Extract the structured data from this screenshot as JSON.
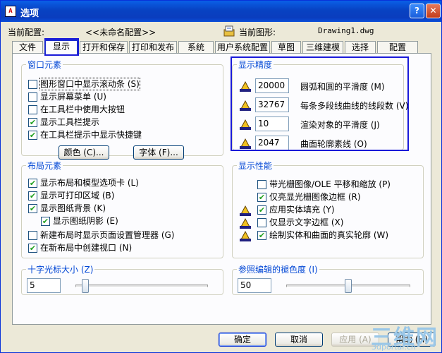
{
  "window": {
    "title": "选项",
    "app_icon_text": "A"
  },
  "titlebar": {
    "help_glyph": "?",
    "close_glyph": "✕"
  },
  "config": {
    "current_profile_label": "当前配置:",
    "current_profile_value": "<<未命名配置>>",
    "current_drawing_label": "当前图形:",
    "current_drawing_value": "Drawing1.dwg"
  },
  "tabs": [
    "文件",
    "显示",
    "打开和保存",
    "打印和发布",
    "系统",
    "用户系统配置",
    "草图",
    "三维建模",
    "选择",
    "配置"
  ],
  "window_elements": {
    "legend": "窗口元素",
    "options": [
      {
        "label": "图形窗口中显示滚动条 (S)",
        "checked": false
      },
      {
        "label": "显示屏幕菜单 (U)",
        "checked": false
      },
      {
        "label": "在工具栏中使用大按钮",
        "checked": false
      },
      {
        "label": "显示工具栏提示",
        "checked": true
      },
      {
        "label": "在工具栏提示中显示快捷键",
        "checked": true
      }
    ],
    "color_button": "颜色 (C)...",
    "font_button": "字体 (F)..."
  },
  "display_resolution": {
    "legend": "显示精度",
    "items": [
      {
        "value": "20000",
        "label": "圆弧和圆的平滑度 (M)"
      },
      {
        "value": "32767",
        "label": "每条多段线曲线的线段数 (V)"
      },
      {
        "value": "10",
        "label": "渲染对象的平滑度 (J)"
      },
      {
        "value": "2047",
        "label": "曲面轮廓素线 (O)"
      }
    ]
  },
  "layout_elements": {
    "legend": "布局元素",
    "options": [
      {
        "label": "显示布局和模型选项卡 (L)",
        "checked": true
      },
      {
        "label": "显示可打印区域 (B)",
        "checked": true
      },
      {
        "label": "显示图纸背景 (K)",
        "checked": true
      },
      {
        "label": "显示图纸阴影 (E)",
        "checked": true
      },
      {
        "label": "新建布局时显示页面设置管理器 (G)",
        "checked": false
      },
      {
        "label": "在新布局中创建视口 (N)",
        "checked": true
      }
    ]
  },
  "display_performance": {
    "legend": "显示性能",
    "options": [
      {
        "label": "带光栅图像/OLE 平移和缩放 (P)",
        "checked": false
      },
      {
        "label": "仅亮显光栅图像边框 (R)",
        "checked": true
      },
      {
        "label": "应用实体填充 (Y)",
        "checked": true
      },
      {
        "label": "仅显示文字边框 (X)",
        "checked": false
      },
      {
        "label": "绘制实体和曲面的真实轮廓 (W)",
        "checked": true
      }
    ]
  },
  "crosshair": {
    "legend": "十字光标大小 (Z)",
    "value": "5",
    "fraction": 0.05
  },
  "xref_fade": {
    "legend": "参照编辑的褪色度 (I)",
    "value": "50",
    "fraction": 0.5
  },
  "footer": {
    "ok": "确定",
    "cancel": "取消",
    "apply": "应用 (A)",
    "help": "帮助 (H)"
  },
  "watermark": {
    "brand": "三维网",
    "site": "3dportal.cn"
  },
  "colors": {
    "accent": "#0046d5",
    "highlight": "#1a1ad8",
    "check": "#21a121"
  }
}
